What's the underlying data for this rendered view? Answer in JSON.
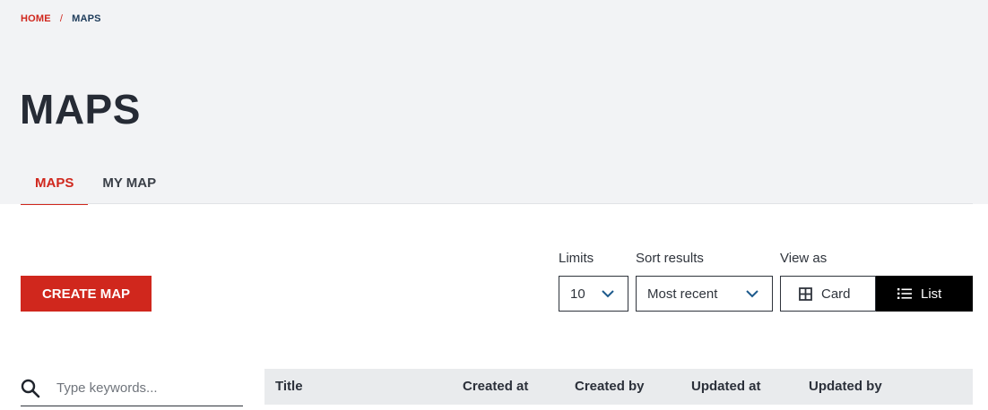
{
  "breadcrumb": {
    "home": "HOME",
    "separator": "/",
    "current": "MAPS"
  },
  "page_title": "MAPS",
  "tabs": [
    {
      "label": "MAPS",
      "active": true
    },
    {
      "label": "MY MAP",
      "active": false
    }
  ],
  "toolbar": {
    "create_label": "CREATE MAP",
    "limits": {
      "label": "Limits",
      "value": "10"
    },
    "sort": {
      "label": "Sort results",
      "value": "Most recent"
    },
    "view": {
      "label": "View as",
      "card_label": "Card",
      "list_label": "List",
      "selected": "List"
    }
  },
  "search": {
    "placeholder": "Type keywords..."
  },
  "table": {
    "columns": [
      "Title",
      "Created at",
      "Created by",
      "Updated at",
      "Updated by"
    ]
  },
  "colors": {
    "accent": "#d0271d",
    "header_bg": "#f2f3f5",
    "dark": "#000000",
    "table_head_bg": "#e9ebed"
  },
  "icons": [
    "chevron-down-icon",
    "grid-icon",
    "list-icon",
    "search-icon"
  ]
}
